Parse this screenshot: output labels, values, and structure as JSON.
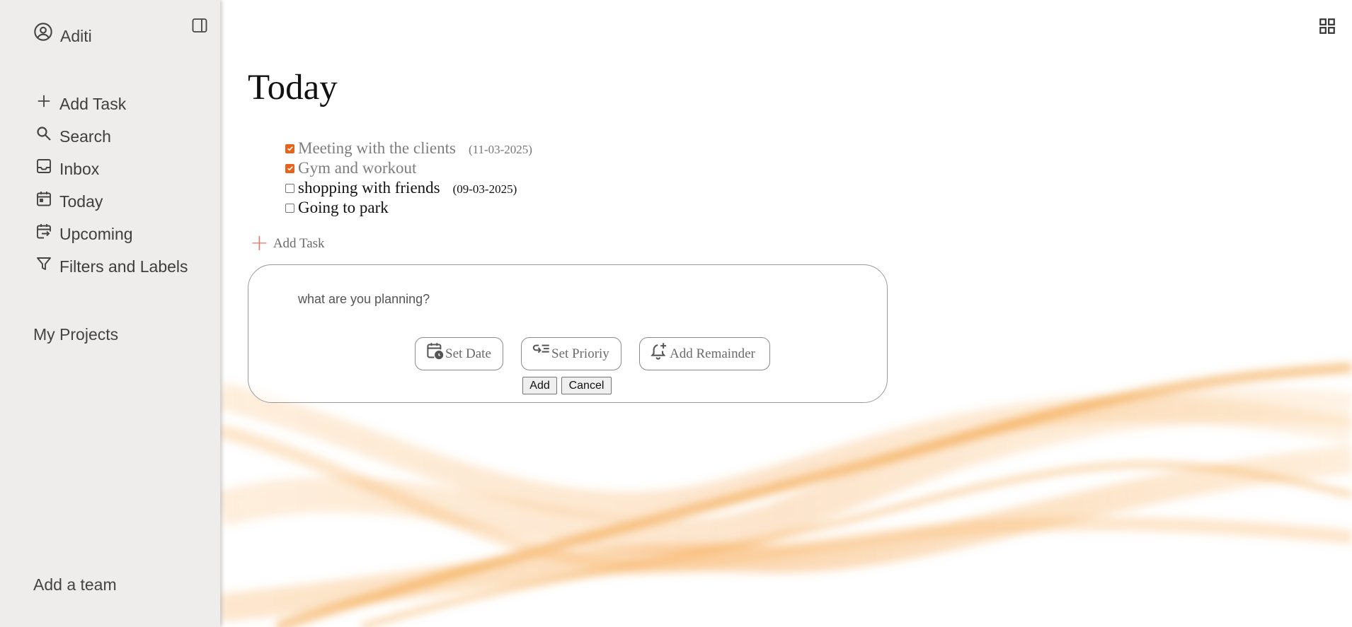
{
  "sidebar": {
    "user_name": "Aditi",
    "items": [
      {
        "label": "Add Task",
        "icon": "plus-icon"
      },
      {
        "label": "Search",
        "icon": "search-icon"
      },
      {
        "label": "Inbox",
        "icon": "inbox-icon"
      },
      {
        "label": "Today",
        "icon": "calendar-icon"
      },
      {
        "label": "Upcoming",
        "icon": "calendar-upcoming-icon"
      },
      {
        "label": "Filters and Labels",
        "icon": "filter-icon"
      }
    ],
    "my_projects": "My Projects",
    "add_team": "Add a team"
  },
  "main": {
    "title": "Today",
    "tasks": [
      {
        "label": "Meeting with the clients",
        "date": "(11-03-2025)",
        "checked": true
      },
      {
        "label": "Gym and workout",
        "date": "",
        "checked": true
      },
      {
        "label": "shopping with friends",
        "date": "(09-03-2025)",
        "checked": false
      },
      {
        "label": "Going to park",
        "date": "",
        "checked": false
      }
    ],
    "add_task_label": "Add Task",
    "form": {
      "placeholder": "what are you planning?",
      "set_date": "Set Date",
      "set_priority": "Set Prioriy",
      "add_reminder": "Add Remainder",
      "add": "Add",
      "cancel": "Cancel"
    }
  },
  "colors": {
    "accent": "#e8621a",
    "sidebar_bg": "#eeedeb",
    "plus": "#e8776a"
  }
}
